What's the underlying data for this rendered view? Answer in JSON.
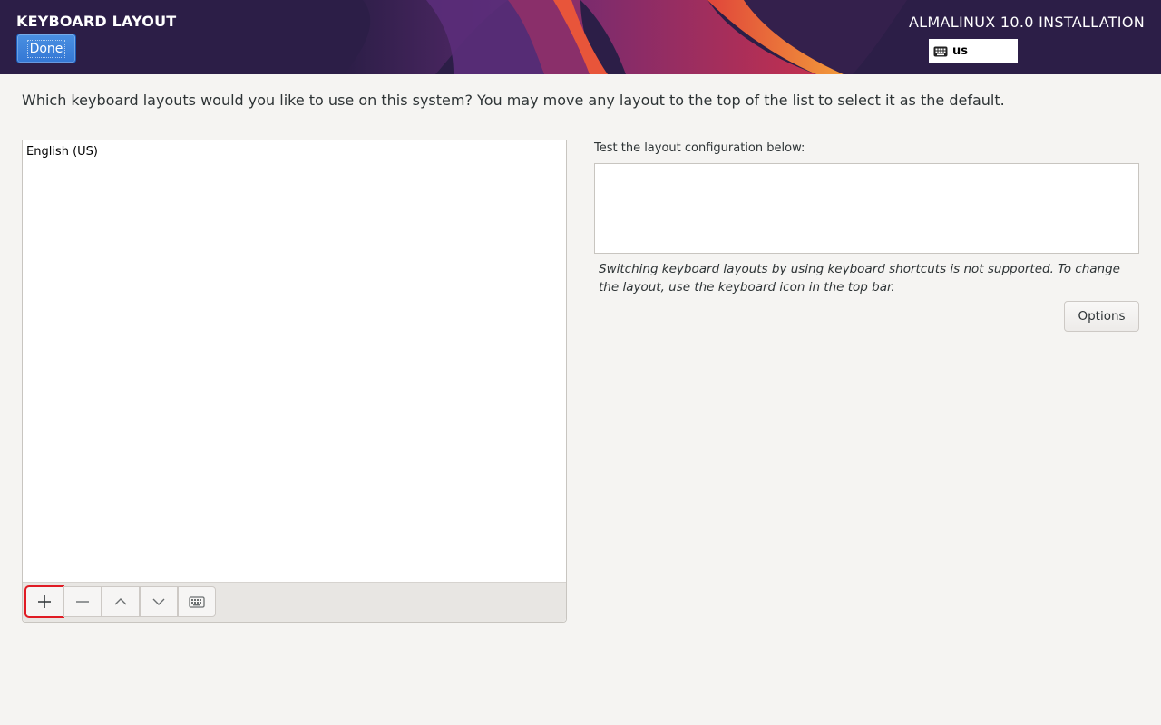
{
  "header": {
    "title": "KEYBOARD LAYOUT",
    "done_label": "Done",
    "product": "ALMALINUX 10.0 INSTALLATION",
    "layout_indicator": "us",
    "layout_indicator_icon": "keyboard-icon"
  },
  "main": {
    "instructions": "Which keyboard layouts would you like to use on this system?  You may move any layout to the top of the list to select it as the default.",
    "layouts": [
      "English (US)"
    ],
    "toolbar": {
      "add_icon": "plus-icon",
      "remove_icon": "minus-icon",
      "up_icon": "chevron-up-icon",
      "down_icon": "chevron-down-icon",
      "preview_icon": "keyboard-icon"
    }
  },
  "test": {
    "label": "Test the layout configuration below:",
    "value": "",
    "note": "Switching keyboard layouts by using keyboard shortcuts is not supported. To change the layout, use the keyboard icon in the top bar.",
    "options_label": "Options"
  },
  "colors": {
    "header_bg": "#2c1e47",
    "accent": "#3477d4",
    "focus": "#e01b24"
  }
}
